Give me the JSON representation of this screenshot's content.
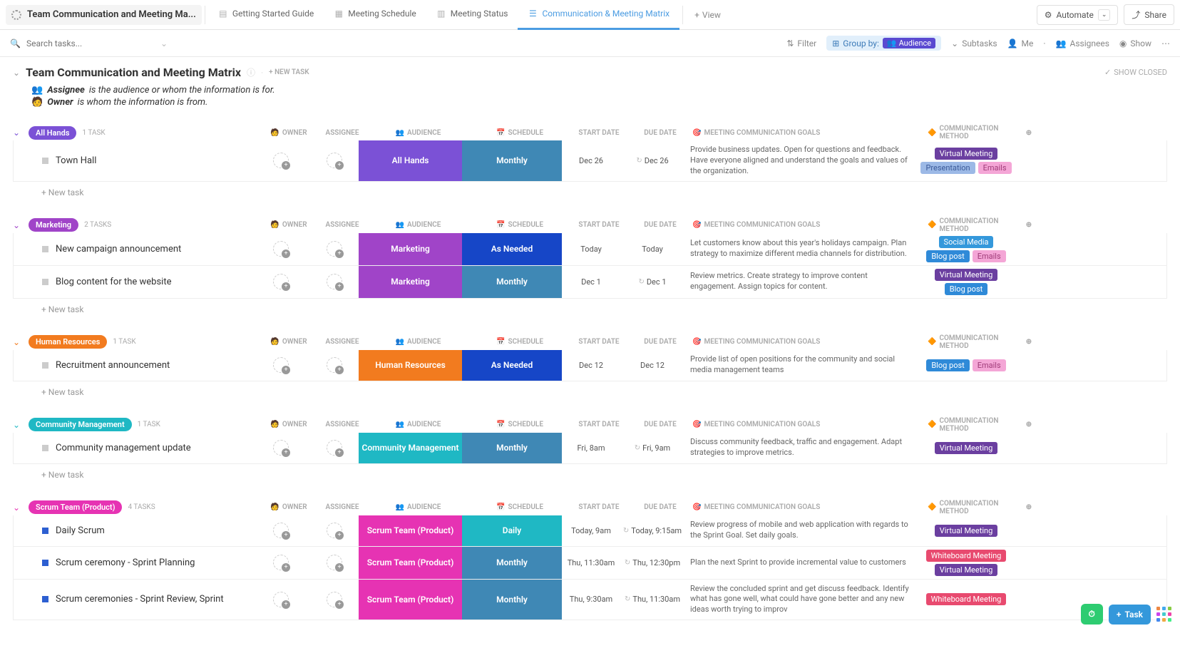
{
  "breadcrumb": "Team Communication and Meeting Ma...",
  "tabs": {
    "guide": "Getting Started Guide",
    "schedule": "Meeting Schedule",
    "status": "Meeting Status",
    "matrix": "Communication & Meeting Matrix",
    "view": "View"
  },
  "topbar": {
    "automate": "Automate",
    "share": "Share"
  },
  "toolbar": {
    "search_ph": "Search tasks...",
    "filter": "Filter",
    "groupby": "Group by:",
    "audience": "Audience",
    "subtasks": "Subtasks",
    "me": "Me",
    "assignees": "Assignees",
    "show": "Show"
  },
  "page": {
    "title": "Team Communication and Meeting Matrix",
    "newtask": "+ NEW TASK",
    "show_closed": "SHOW CLOSED"
  },
  "desc": {
    "l1a": "Assignee",
    "l1b": "is the audience or whom the information is for.",
    "l2a": "Owner",
    "l2b": "is whom the information is from."
  },
  "columns": {
    "owner": "OWNER",
    "assignee": "ASSIGNEE",
    "audience": "AUDIENCE",
    "schedule": "SCHEDULE",
    "start": "START DATE",
    "due": "DUE DATE",
    "goals": "MEETING COMMUNICATION GOALS",
    "method": "COMMUNICATION METHOD"
  },
  "newtask_row": "+ New task",
  "groups": [
    {
      "name": "All Hands",
      "color": "#7b51d6",
      "count": "1 TASK",
      "tasks": [
        {
          "title": "Town Hall",
          "sq": "#ccc",
          "aud": "All Hands",
          "audcol": "#7b51d6",
          "sched": "Monthly",
          "schedcol": "#3f88b5",
          "start": "Dec 26",
          "due": "Dec 26",
          "recur": true,
          "goals": "Provide business updates. Open for questions and feedback. Have everyone aligned and understand the goals and values of the organization.",
          "tags": [
            [
              "t-vmeeting",
              "Virtual Meeting"
            ]
          ],
          "tags2": [
            [
              "t-present",
              "Presentation"
            ],
            [
              "t-emails",
              "Emails"
            ]
          ]
        }
      ]
    },
    {
      "name": "Marketing",
      "color": "#a044c8",
      "count": "2 TASKS",
      "tasks": [
        {
          "title": "New campaign announcement",
          "sq": "#ccc",
          "aud": "Marketing",
          "audcol": "#a044c8",
          "sched": "As Needed",
          "schedcol": "#1646c7",
          "start": "Today",
          "startred": true,
          "due": "Today",
          "duered": true,
          "goals": "Let customers know about this year's holidays campaign. Plan strategy to maximize different media channels for distribution.",
          "tags": [
            [
              "t-social",
              "Social Media"
            ]
          ],
          "tags2": [
            [
              "t-blog",
              "Blog post"
            ],
            [
              "t-emails",
              "Emails"
            ]
          ]
        },
        {
          "title": "Blog content for the website",
          "sq": "#ccc",
          "aud": "Marketing",
          "audcol": "#a044c8",
          "sched": "Monthly",
          "schedcol": "#3f88b5",
          "start": "Dec 1",
          "due": "Dec 1",
          "recur": true,
          "goals": "Review metrics. Create strategy to improve content engagement. Assign topics for content.",
          "tags": [
            [
              "t-vmeeting",
              "Virtual Meeting"
            ]
          ],
          "tags2": [
            [
              "t-blog",
              "Blog post"
            ]
          ]
        }
      ]
    },
    {
      "name": "Human Resources",
      "color": "#f27b1f",
      "count": "1 TASK",
      "tasks": [
        {
          "title": "Recruitment announcement",
          "sq": "#ccc",
          "aud": "Human Resources",
          "audcol": "#f27b1f",
          "sched": "As Needed",
          "schedcol": "#1646c7",
          "start": "Dec 12",
          "due": "Dec 12",
          "goals": "Provide list of open positions for the community and social media management teams",
          "tags": [
            [
              "t-blog",
              "Blog post"
            ],
            [
              "t-emails",
              "Emails"
            ]
          ]
        }
      ]
    },
    {
      "name": "Community Management",
      "color": "#1fb8c4",
      "count": "1 TASK",
      "tasks": [
        {
          "title": "Community management update",
          "sq": "#ccc",
          "aud": "Community Management",
          "audcol": "#1fb8c4",
          "sched": "Monthly",
          "schedcol": "#3f88b5",
          "start": "Fri, 8am",
          "due": "Fri, 9am",
          "recur": true,
          "goals": "Discuss community feedback, traffic and engagement. Adapt strategies to improve metrics.",
          "tags": [
            [
              "t-vmeeting",
              "Virtual Meeting"
            ]
          ]
        }
      ]
    },
    {
      "name": "Scrum Team (Product)",
      "color": "#e633b3",
      "count": "4 TASKS",
      "nonew": true,
      "tasks": [
        {
          "title": "Daily Scrum",
          "sq": "#2d5fd1",
          "aud": "Scrum Team (Product)",
          "audcol": "#e633b3",
          "sched": "Daily",
          "schedcol": "#1fb8c4",
          "start": "Today, 9am",
          "startred": true,
          "due": "Today, 9:15am",
          "duered": true,
          "recur": true,
          "goals": "Review progress of mobile and web application with regards to the Sprint Goal. Set daily goals.",
          "tags": [
            [
              "t-vmeeting",
              "Virtual Meeting"
            ]
          ]
        },
        {
          "title": "Scrum ceremony - Sprint Planning",
          "sq": "#2d5fd1",
          "aud": "Scrum Team (Product)",
          "audcol": "#e633b3",
          "sched": "Monthly",
          "schedcol": "#3f88b5",
          "start": "Thu, 11:30am",
          "due": "Thu, 12:30pm",
          "recur": true,
          "goals": "Plan the next Sprint to provide incremental value to customers",
          "tags": [
            [
              "t-wboard",
              "Whiteboard Meeting"
            ]
          ],
          "tags2": [
            [
              "t-vmeeting",
              "Virtual Meeting"
            ]
          ]
        },
        {
          "title": "Scrum ceremonies - Sprint Review, Sprint",
          "sq": "#2d5fd1",
          "aud": "Scrum Team (Product)",
          "audcol": "#e633b3",
          "sched": "Monthly",
          "schedcol": "#3f88b5",
          "start": "Thu, 9:30am",
          "due": "Thu, 11:30am",
          "recur": true,
          "goals": "Review the concluded sprint and get discuss feedback. Identify what has gone well, what could have gone better and any new ideas worth trying to improv",
          "tags": [
            [
              "t-wboard",
              "Whiteboard Meeting"
            ]
          ]
        }
      ]
    }
  ],
  "fab": {
    "task": "Task"
  }
}
